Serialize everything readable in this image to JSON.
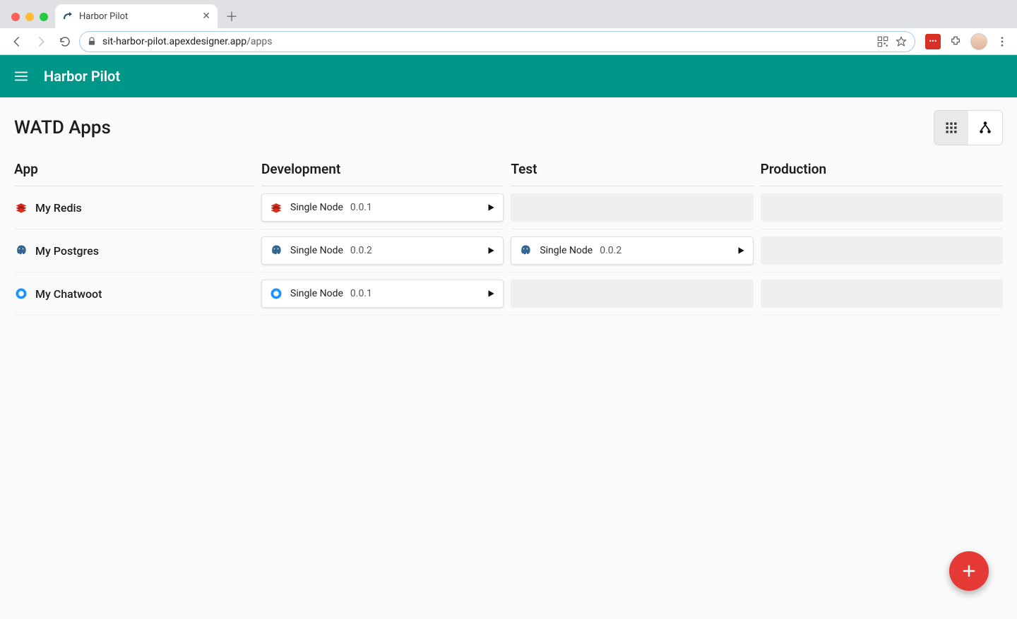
{
  "browser": {
    "tab_title": "Harbor Pilot",
    "url_host": "sit-harbor-pilot.apexdesigner.app",
    "url_path": "/apps"
  },
  "header": {
    "title": "Harbor Pilot"
  },
  "page": {
    "title": "WATD Apps"
  },
  "columns": {
    "app": "App",
    "dev": "Development",
    "test": "Test",
    "prod": "Production"
  },
  "apps": [
    {
      "name": "My Redis",
      "icon": "redis",
      "dev": {
        "label": "Single Node",
        "version": "0.0.1"
      },
      "test": null,
      "prod": null
    },
    {
      "name": "My Postgres",
      "icon": "postgres",
      "dev": {
        "label": "Single Node",
        "version": "0.0.2"
      },
      "test": {
        "label": "Single Node",
        "version": "0.0.2"
      },
      "prod": null
    },
    {
      "name": "My Chatwoot",
      "icon": "chatwoot",
      "dev": {
        "label": "Single Node",
        "version": "0.0.1"
      },
      "test": null,
      "prod": null
    }
  ]
}
